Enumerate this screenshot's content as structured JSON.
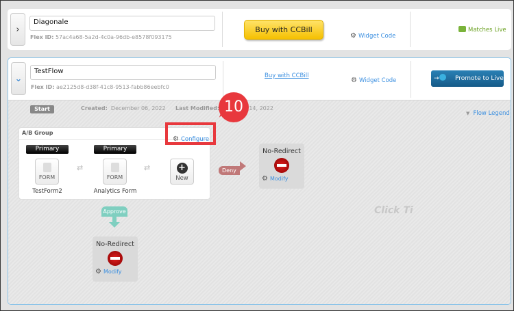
{
  "flows": [
    {
      "name": "Diagonale",
      "flex_id_label": "Flex ID:",
      "flex_id": "57ac4a68-5a2d-4c0a-96db-e8578f093175",
      "buy_label": "Buy with CCBill",
      "widget_label": "Widget Code",
      "status": "Matches Live"
    },
    {
      "name": "TestFlow",
      "flex_id_label": "Flex ID:",
      "flex_id": "ae2125d8-d38f-41c8-9513-fabb86eebfc0",
      "buy_label": "Buy with CCBill",
      "widget_label": "Widget Code",
      "promote_label": "Promote to Live"
    }
  ],
  "meta": {
    "start": "Start",
    "created_label": "Created:",
    "created": "December 06, 2022",
    "modified_label": "Last Modified:",
    "modified": "14, 2022",
    "legend": "Flow Legend"
  },
  "ab_group": {
    "title": "A/B Group",
    "configure": "Configure",
    "forms": [
      {
        "tag": "Primary",
        "icon": "FORM",
        "name": "TestForm2"
      },
      {
        "tag": "Primary",
        "icon": "FORM",
        "name": "Analytics Form"
      }
    ],
    "new_label": "New"
  },
  "deny": "Deny",
  "approve": "Approve",
  "redirects": [
    {
      "title": "No-Redirect",
      "modify": "Modify"
    },
    {
      "title": "No-Redirect",
      "modify": "Modify"
    }
  ],
  "canvas_hint": "Click Ti",
  "callout": "10"
}
